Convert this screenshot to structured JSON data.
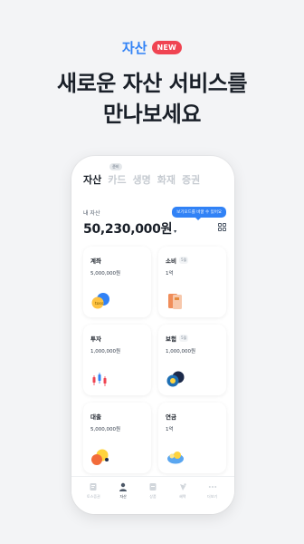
{
  "hero": {
    "tag": "자산",
    "badge": "NEW",
    "title_line1": "새로운 자산 서비스를",
    "title_line2": "만나보세요"
  },
  "tabs": [
    {
      "label": "자산",
      "active": true
    },
    {
      "label": "카드",
      "active": false,
      "badge": "준비"
    },
    {
      "label": "생명",
      "active": false
    },
    {
      "label": "화재",
      "active": false
    },
    {
      "label": "증권",
      "active": false
    }
  ],
  "tooltip": "보기모드를 바꿀 수 있어요",
  "asset": {
    "label": "내 자산",
    "amount": "50,230,000원",
    "caret": "▾"
  },
  "cards": [
    {
      "title": "계좌",
      "value": "5,000,000원",
      "month": "",
      "icon": "bank-coins-icon"
    },
    {
      "title": "소비",
      "value": "1억",
      "month": "5월",
      "icon": "card-stack-icon"
    },
    {
      "title": "투자",
      "value": "1,000,000원",
      "month": "",
      "icon": "candle-chart-icon"
    },
    {
      "title": "보험",
      "value": "1,000,000원",
      "month": "5월",
      "icon": "umbrella-shield-icon"
    },
    {
      "title": "대출",
      "value": "5,000,000원",
      "month": "",
      "icon": "loan-coins-icon"
    },
    {
      "title": "연금",
      "value": "1억",
      "month": "",
      "icon": "pension-piggy-icon"
    }
  ],
  "nav": [
    {
      "label": "토스증권",
      "icon": "home-doc-icon",
      "active": false
    },
    {
      "label": "자산",
      "icon": "person-icon",
      "active": true
    },
    {
      "label": "상품",
      "icon": "box-icon",
      "active": false
    },
    {
      "label": "혜택",
      "icon": "gift-icon",
      "active": false
    },
    {
      "label": "더보기",
      "icon": "more-dots-icon",
      "active": false
    }
  ],
  "colors": {
    "accent": "#3182f6",
    "new_badge": "#f04452",
    "background": "#f3f4f6"
  }
}
